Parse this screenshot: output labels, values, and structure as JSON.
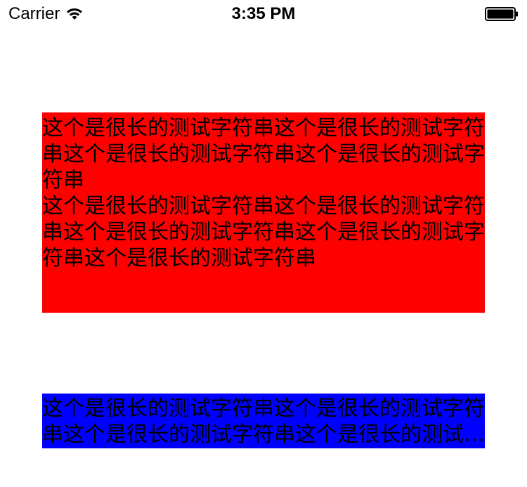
{
  "status_bar": {
    "carrier": "Carrier",
    "time": "3:35 PM",
    "wifi_icon": "wifi-icon",
    "battery_icon": "battery-icon"
  },
  "red_label": {
    "background": "#ff0000",
    "paragraphs": [
      "这个是很长的测试字符串这个是很长的测试字符串这个是很长的测试字符串这个是很长的测试字符串",
      "这个是很长的测试字符串这个是很长的测试字符串这个是很长的测试字符串这个是很长的测试字符串这个是很长的测试字符串"
    ]
  },
  "blue_label": {
    "background": "#0000ff",
    "text": "这个是很长的测试字符串这个是很长的测试字符串这个是很长的测试字符串这个是很长的测试字符串"
  }
}
